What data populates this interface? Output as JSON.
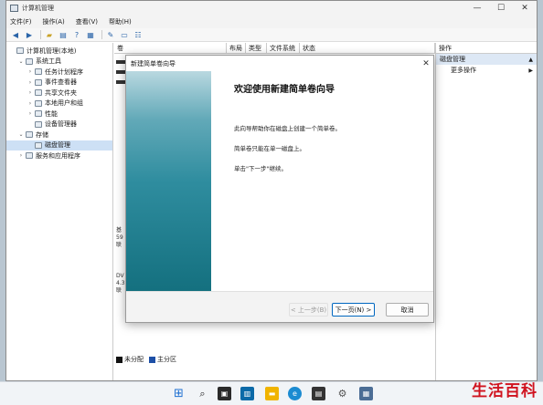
{
  "window": {
    "title": "计算机管理",
    "min": "—",
    "max": "☐",
    "close": "✕"
  },
  "menu": [
    "文件(F)",
    "操作(A)",
    "查看(V)",
    "帮助(H)"
  ],
  "tree": [
    {
      "label": "计算机管理(本地)",
      "level": 0,
      "chevron": ""
    },
    {
      "label": "系统工具",
      "level": 1,
      "chevron": "⌄"
    },
    {
      "label": "任务计划程序",
      "level": 2,
      "chevron": "›"
    },
    {
      "label": "事件查看器",
      "level": 2,
      "chevron": "›"
    },
    {
      "label": "共享文件夹",
      "level": 2,
      "chevron": "›"
    },
    {
      "label": "本地用户和组",
      "level": 2,
      "chevron": "›"
    },
    {
      "label": "性能",
      "level": 2,
      "chevron": "›"
    },
    {
      "label": "设备管理器",
      "level": 2,
      "chevron": ""
    },
    {
      "label": "存储",
      "level": 1,
      "chevron": "⌄"
    },
    {
      "label": "磁盘管理",
      "level": 2,
      "chevron": "",
      "selected": true
    },
    {
      "label": "服务和应用程序",
      "level": 1,
      "chevron": "›"
    }
  ],
  "columns": [
    "卷",
    "布局",
    "类型",
    "文件系统",
    "状态"
  ],
  "disk_fragments": [
    {
      "lines": [
        "基",
        "59",
        "联"
      ]
    },
    {
      "lines": [
        "DV",
        "4.3",
        "联"
      ]
    }
  ],
  "legend": {
    "unallocated": "未分配",
    "primary": "主分区"
  },
  "actions": {
    "header": "操作",
    "group": "磁盘管理",
    "more": "更多操作"
  },
  "dialog": {
    "title": "新建简单卷向导",
    "heading": "欢迎使用新建简单卷向导",
    "p1": "此向导帮助你在磁盘上创建一个简单卷。",
    "p2": "简单卷只能在单一磁盘上。",
    "p3": "单击\"下一步\"继续。",
    "back": "< 上一步(B)",
    "next": "下一页(N) >",
    "cancel": "取消"
  },
  "watermark": "生活百科",
  "colors": {
    "accent": "#0067c0",
    "banner_dark": "#14707f",
    "watermark": "#d0131f"
  }
}
